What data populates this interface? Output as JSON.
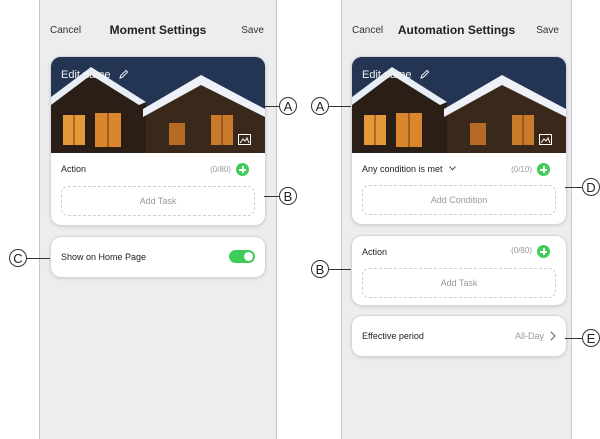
{
  "left_screen": {
    "cancel_label": "Cancel",
    "title": "Moment Settings",
    "save_label": "Save",
    "edit_name_label": "Edit name",
    "action_label": "Action",
    "action_count": "(0/80)",
    "add_task_label": "Add Task",
    "show_on_home_label": "Show on Home Page",
    "show_on_home_enabled": true
  },
  "right_screen": {
    "cancel_label": "Cancel",
    "title": "Automation Settings",
    "save_label": "Save",
    "edit_name_label": "Edit name",
    "condition_label": "Any condition is met",
    "condition_count": "(0/10)",
    "add_condition_label": "Add Condition",
    "action_label": "Action",
    "action_count": "(0/80)",
    "add_task_label": "Add Task",
    "effective_period_label": "Effective period",
    "effective_period_value": "All-Day"
  },
  "callouts": {
    "a_left": "A",
    "a_right": "A",
    "b_left": "B",
    "b_right": "B",
    "c": "C",
    "d": "D",
    "e": "E"
  },
  "colors": {
    "accent_green": "#3dcd58",
    "screen_background": "#ededef"
  },
  "icons": [
    "pencil-icon",
    "image-icon",
    "plus-circle-icon",
    "chevron-down-icon",
    "chevron-right-icon",
    "toggle-switch"
  ]
}
